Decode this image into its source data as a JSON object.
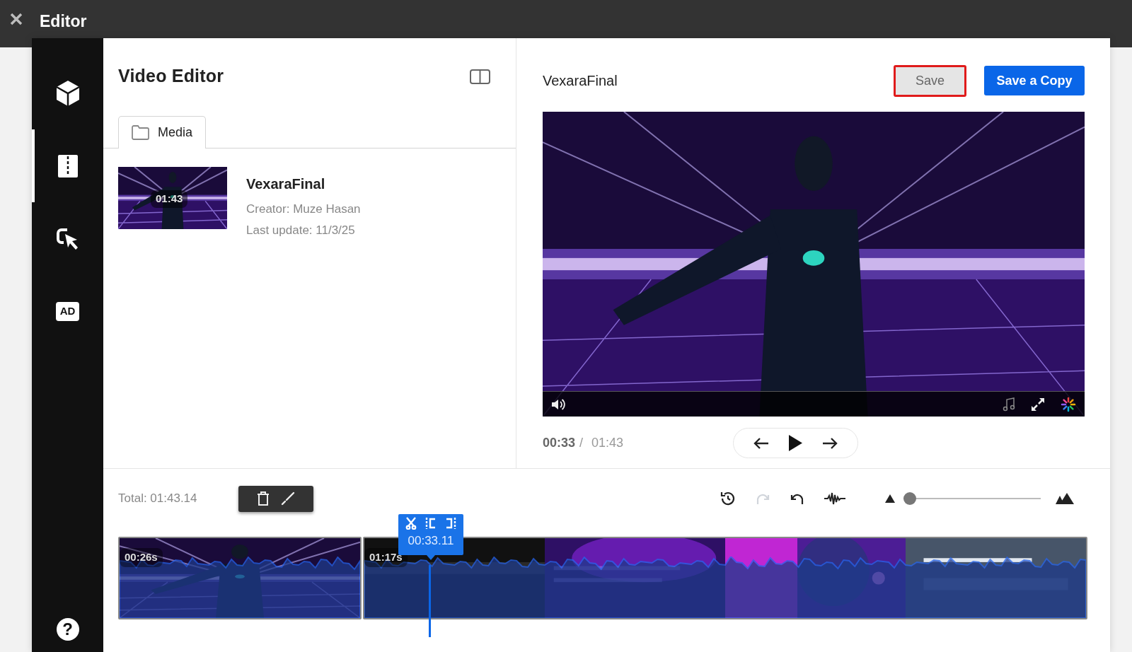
{
  "app_bar": {
    "title": "Editor"
  },
  "sidebar": {
    "items": [
      {
        "kind": "cube",
        "selected": false
      },
      {
        "kind": "split",
        "selected": true
      },
      {
        "kind": "cursor",
        "selected": false
      },
      {
        "kind": "ad",
        "label": "AD",
        "selected": false
      }
    ],
    "help": "?"
  },
  "media_panel": {
    "title": "Video Editor",
    "tabs": [
      {
        "label": "Media",
        "selected": true
      }
    ],
    "items": [
      {
        "name": "VexaraFinal",
        "duration": "01:43",
        "creator": "Creator: Muze Hasan",
        "updated": "Last update: 11/3/25"
      }
    ]
  },
  "preview": {
    "title": "VexaraFinal",
    "buttons": [
      {
        "label": "Save",
        "kind": "secondary",
        "focused": true
      },
      {
        "label": "Save a Copy",
        "kind": "primary",
        "focused": false
      }
    ],
    "current_time": "00:33",
    "separator": "/",
    "duration": "01:43"
  },
  "timeline": {
    "total": "Total: 01:43.14",
    "tools": [
      {
        "kind": "reset",
        "disabled": false
      },
      {
        "kind": "redo",
        "disabled": true
      },
      {
        "kind": "undo",
        "disabled": false
      },
      {
        "kind": "waveform",
        "disabled": false
      }
    ],
    "zoom": {
      "level": 0
    },
    "playhead": {
      "time": "00:33.11"
    },
    "clips": [
      {
        "duration": "00:26s"
      },
      {
        "duration": "01:17s"
      }
    ]
  }
}
